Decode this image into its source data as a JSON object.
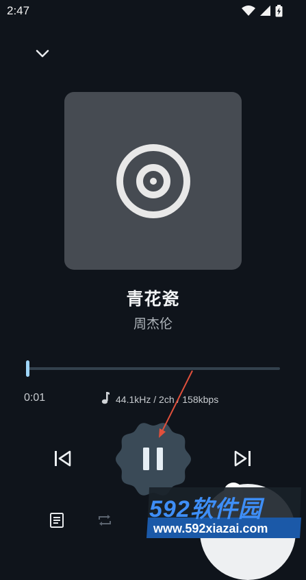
{
  "status_bar": {
    "time": "2:47",
    "icons": [
      "wifi-icon",
      "signal-icon",
      "battery-charging-icon"
    ]
  },
  "player": {
    "collapse_icon": "chevron-down-icon",
    "artwork_icon": "vinyl-record-icon",
    "title": "青花瓷",
    "artist": "周杰伦",
    "progress_fraction": 0.003,
    "elapsed": "0:01",
    "audio_info": "44.1kHz / 2ch / 158kbps",
    "audio_info_icon": "music-note-icon",
    "controls": {
      "previous_icon": "skip-previous-icon",
      "play_pause_icon": "pause-icon",
      "next_icon": "skip-next-icon"
    },
    "bottom_bar": {
      "queue_icon": "queue-list-icon",
      "repeat_icon": "repeat-icon"
    }
  },
  "watermark": {
    "brand": "592软件园",
    "url": "www.592xiazai.com"
  },
  "colors": {
    "background": "#0f141b",
    "artwork_bg": "#464b52",
    "accent": "#8fcdf5",
    "play_button": "#3a4a57",
    "annotation_arrow": "#e0503c"
  }
}
